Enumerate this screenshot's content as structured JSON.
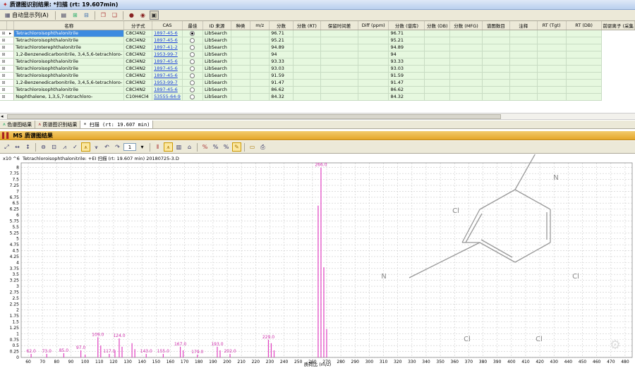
{
  "title_bar": {
    "title": "质谱图识别结果: *扫描 (rt: 19.607min)"
  },
  "toolbar1": {
    "auto_display_label": "自动显示列(A)"
  },
  "grid": {
    "columns": [
      "名称",
      "分子式",
      "CAS",
      "最佳",
      "ID 来源",
      "种类",
      "m/z",
      "分数",
      "分数 (RT)",
      "保留时间差",
      "Diff (ppm)",
      "分数 (谱库)",
      "分数 (DB)",
      "分数 (MFG)",
      "谱图数目",
      "注释",
      "RT (Tgt)",
      "RT (DB)",
      "前驱离子 (采集"
    ],
    "rows": [
      {
        "name": "Tetrachloroisophthalonitrile",
        "formula": "C8Cl4N2",
        "cas": "1897-45-6",
        "best": true,
        "source": "LibSearch",
        "score": "96.71",
        "score_lib": "96.71",
        "selected": true
      },
      {
        "name": "Tetrachloroisophthalonitrile",
        "formula": "C8Cl4N2",
        "cas": "1897-45-6",
        "best": false,
        "source": "LibSearch",
        "score": "95.21",
        "score_lib": "95.21",
        "selected": false
      },
      {
        "name": "Tetrachloroterephthalonitrile",
        "formula": "C8Cl4N2",
        "cas": "1897-41-2",
        "best": false,
        "source": "LibSearch",
        "score": "94.89",
        "score_lib": "94.89",
        "selected": false
      },
      {
        "name": "1,2-Benzenedicarbonitrile, 3,4,5,6-tetrachloro-",
        "formula": "C8Cl4N2",
        "cas": "1953-99-7",
        "best": false,
        "source": "LibSearch",
        "score": "94",
        "score_lib": "94",
        "selected": false
      },
      {
        "name": "Tetrachloroisophthalonitrile",
        "formula": "C8Cl4N2",
        "cas": "1897-45-6",
        "best": false,
        "source": "LibSearch",
        "score": "93.33",
        "score_lib": "93.33",
        "selected": false
      },
      {
        "name": "Tetrachloroisophthalonitrile",
        "formula": "C8Cl4N2",
        "cas": "1897-45-6",
        "best": false,
        "source": "LibSearch",
        "score": "93.03",
        "score_lib": "93.03",
        "selected": false
      },
      {
        "name": "Tetrachloroisophthalonitrile",
        "formula": "C8Cl4N2",
        "cas": "1897-45-6",
        "best": false,
        "source": "LibSearch",
        "score": "91.59",
        "score_lib": "91.59",
        "selected": false
      },
      {
        "name": "1,2-Benzenedicarbonitrile, 3,4,5,6-tetrachloro-",
        "formula": "C8Cl4N2",
        "cas": "1953-99-7",
        "best": false,
        "source": "LibSearch",
        "score": "91.47",
        "score_lib": "91.47",
        "selected": false
      },
      {
        "name": "Tetrachloroisophthalonitrile",
        "formula": "C8Cl4N2",
        "cas": "1897-45-6",
        "best": false,
        "source": "LibSearch",
        "score": "86.62",
        "score_lib": "86.62",
        "selected": false
      },
      {
        "name": "Naphthalene, 1,3,5,7-tetrachloro-",
        "formula": "C10H4Cl4",
        "cas": "53555-64-9",
        "best": false,
        "source": "LibSearch",
        "score": "84.32",
        "score_lib": "84.32",
        "selected": false
      }
    ]
  },
  "tabs": [
    {
      "label": "色谱图结果"
    },
    {
      "label": "质谱图识别结果"
    },
    {
      "label": "* 扫描 (rt: 19.607 min)"
    }
  ],
  "panel": {
    "title": "MS 质谱图结果",
    "page_value": "1"
  },
  "chart_data": {
    "type": "bar",
    "title": "Tetrachloroisophthalonitrile: +EI 扫描 (rt: 19.607 min) 20180725-3.D",
    "y_multiplier": "x10 ^6",
    "ylim": [
      0,
      8.2
    ],
    "xlim": [
      55,
      485
    ],
    "yticks": [
      0,
      0.25,
      0.5,
      0.75,
      1,
      1.25,
      1.5,
      1.75,
      2,
      2.25,
      2.5,
      2.75,
      3,
      3.25,
      3.5,
      3.75,
      4,
      4.25,
      4.5,
      4.75,
      5,
      5.25,
      5.5,
      5.75,
      6,
      6.25,
      6.5,
      6.75,
      7,
      7.25,
      7.5,
      7.75,
      8
    ],
    "xticks": [
      60,
      70,
      80,
      90,
      100,
      110,
      120,
      130,
      140,
      150,
      160,
      170,
      180,
      190,
      200,
      210,
      220,
      230,
      240,
      250,
      260,
      270,
      280,
      290,
      300,
      310,
      320,
      330,
      340,
      350,
      360,
      370,
      380,
      390,
      400,
      410,
      420,
      430,
      440,
      450,
      460,
      470,
      480
    ],
    "xlabel": "质荷比 (m/z)",
    "peaks": [
      {
        "mz": 62.0,
        "value": 0.15,
        "label": "62.0"
      },
      {
        "mz": 73.0,
        "value": 0.15,
        "label": "73.0"
      },
      {
        "mz": 85.0,
        "value": 0.18,
        "label": "85.0"
      },
      {
        "mz": 97.0,
        "value": 0.3,
        "label": "97.0"
      },
      {
        "mz": 100,
        "value": 0.12,
        "label": ""
      },
      {
        "mz": 109.0,
        "value": 0.85,
        "label": "109.0"
      },
      {
        "mz": 111,
        "value": 0.5,
        "label": ""
      },
      {
        "mz": 117.0,
        "value": 0.15,
        "label": "117.0"
      },
      {
        "mz": 121,
        "value": 0.3,
        "label": ""
      },
      {
        "mz": 124.0,
        "value": 0.8,
        "label": "124.0"
      },
      {
        "mz": 126,
        "value": 0.45,
        "label": ""
      },
      {
        "mz": 133,
        "value": 0.6,
        "label": ""
      },
      {
        "mz": 135,
        "value": 0.35,
        "label": ""
      },
      {
        "mz": 143.0,
        "value": 0.15,
        "label": "143.0"
      },
      {
        "mz": 155.0,
        "value": 0.15,
        "label": "155.0"
      },
      {
        "mz": 167.0,
        "value": 0.45,
        "label": "167.0"
      },
      {
        "mz": 169,
        "value": 0.3,
        "label": ""
      },
      {
        "mz": 179.0,
        "value": 0.12,
        "label": "179.0"
      },
      {
        "mz": 193.0,
        "value": 0.45,
        "label": "193.0"
      },
      {
        "mz": 195,
        "value": 0.3,
        "label": ""
      },
      {
        "mz": 202.0,
        "value": 0.15,
        "label": "202.0"
      },
      {
        "mz": 229.0,
        "value": 0.75,
        "label": "229.0"
      },
      {
        "mz": 231,
        "value": 0.6,
        "label": ""
      },
      {
        "mz": 233,
        "value": 0.3,
        "label": ""
      },
      {
        "mz": 264,
        "value": 6.4,
        "label": ""
      },
      {
        "mz": 266.0,
        "value": 8.0,
        "label": "266.0"
      },
      {
        "mz": 268,
        "value": 3.8,
        "label": ""
      },
      {
        "mz": 270,
        "value": 1.2,
        "label": ""
      }
    ]
  },
  "structure": {
    "atoms": [
      "N",
      "Cl",
      "Cl",
      "N",
      "Cl",
      "Cl"
    ]
  }
}
